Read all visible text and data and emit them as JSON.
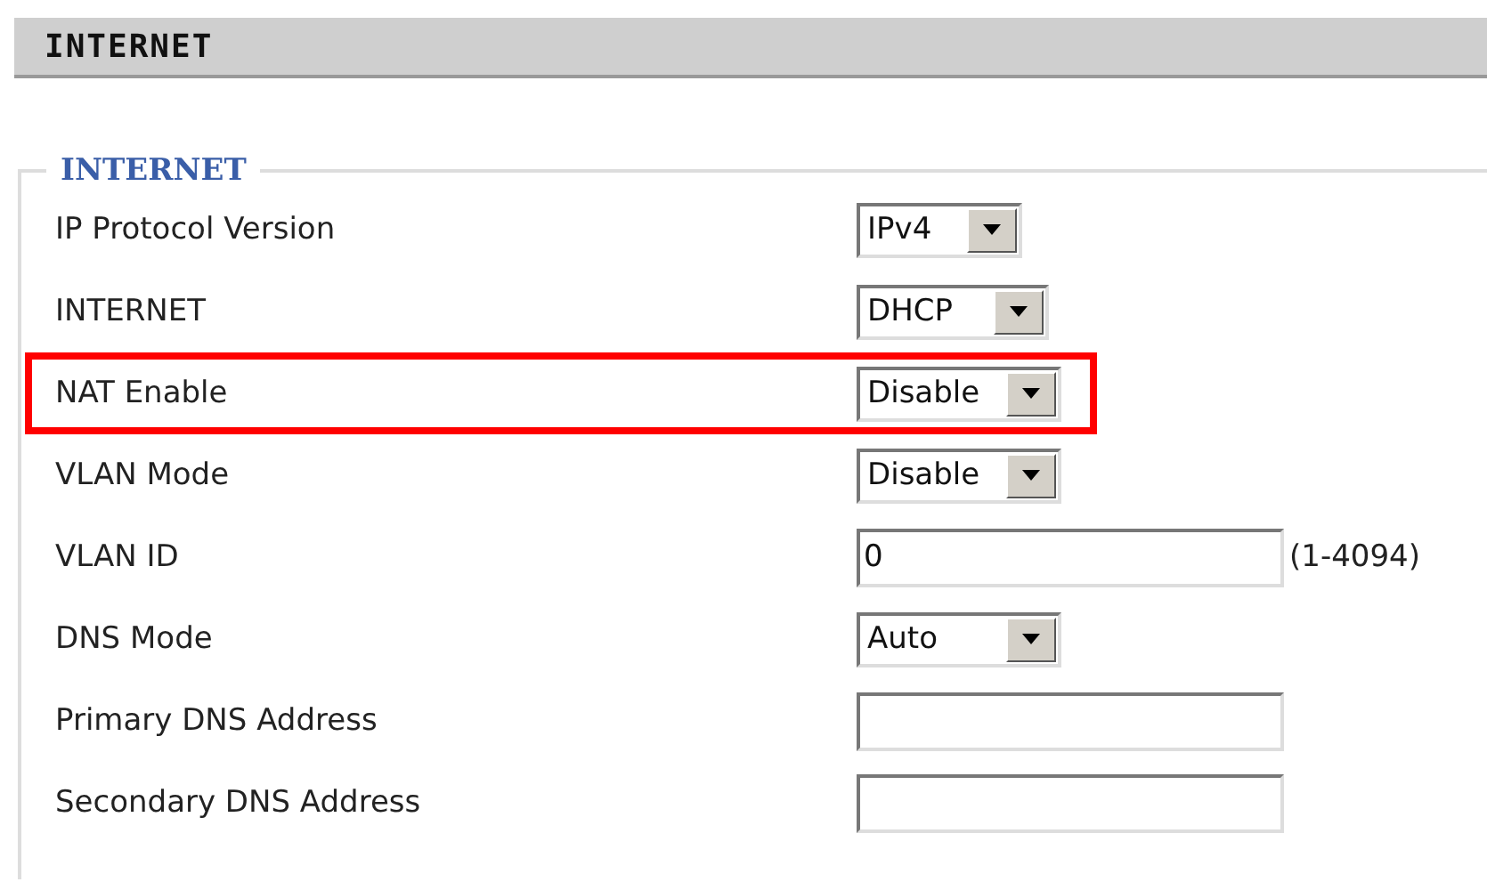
{
  "header": {
    "title": "INTERNET"
  },
  "section": {
    "legend": "INTERNET",
    "rows": [
      {
        "label": "IP Protocol Version",
        "kind": "select",
        "value": "IPv4",
        "highlighted": false
      },
      {
        "label": "INTERNET",
        "kind": "select",
        "value": "DHCP",
        "highlighted": false
      },
      {
        "label": "NAT Enable",
        "kind": "select",
        "value": "Disable",
        "highlighted": true
      },
      {
        "label": "VLAN Mode",
        "kind": "select",
        "value": "Disable",
        "highlighted": false
      },
      {
        "label": "VLAN ID",
        "kind": "text",
        "value": "0",
        "hint": "(1-4094)",
        "highlighted": false
      },
      {
        "label": "DNS Mode",
        "kind": "select",
        "value": "Auto",
        "highlighted": false
      },
      {
        "label": "Primary DNS Address",
        "kind": "text",
        "value": "",
        "highlighted": false
      },
      {
        "label": "Secondary DNS Address",
        "kind": "text",
        "value": "",
        "highlighted": false
      }
    ]
  }
}
